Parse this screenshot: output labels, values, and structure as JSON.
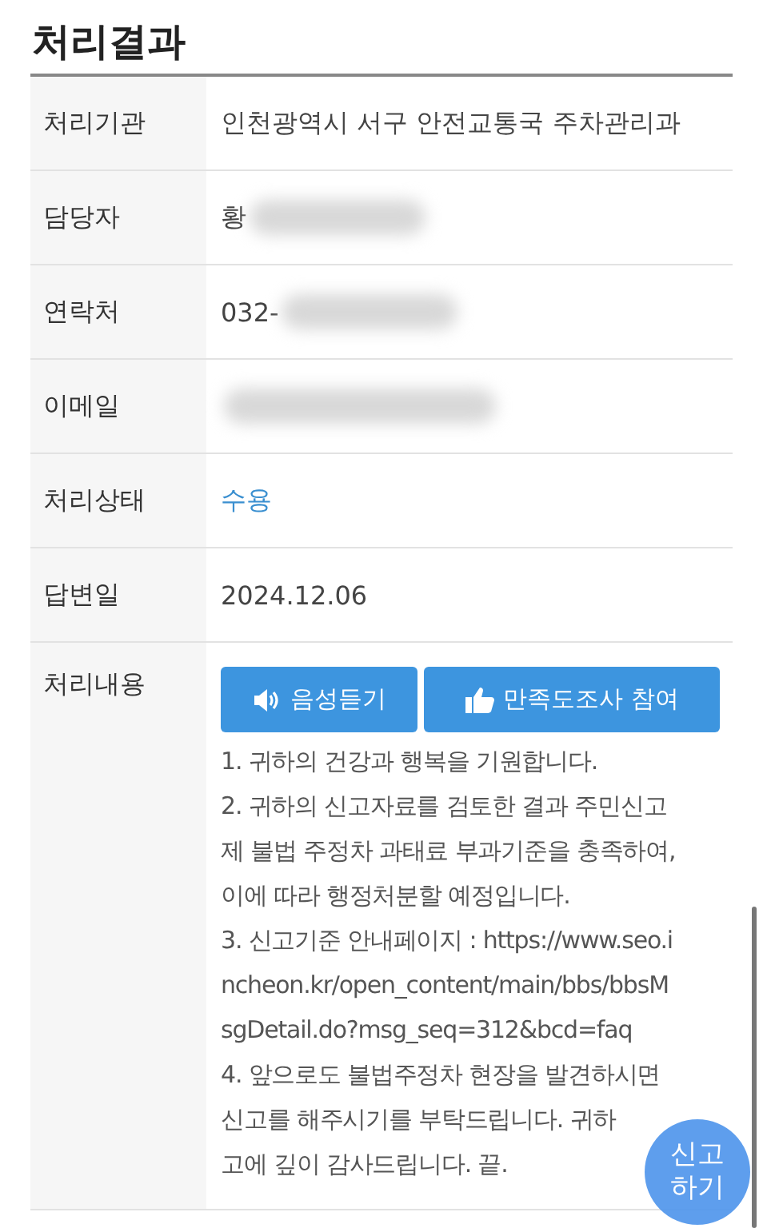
{
  "title": "처리결과",
  "rows": [
    {
      "label": "처리기관",
      "value": "인천광역시 서구 안전교통국 주차관리과",
      "kind": "text",
      "redacted": false
    },
    {
      "label": "담당자",
      "value": "황",
      "kind": "text",
      "redacted": true
    },
    {
      "label": "연락처",
      "value": "032-",
      "kind": "text",
      "redacted": true
    },
    {
      "label": "이메일",
      "kind": "text",
      "redacted": true
    },
    {
      "label": "처리상태",
      "value": "수용",
      "kind": "status",
      "redacted": false
    },
    {
      "label": "답변일",
      "value": "2024.12.06",
      "kind": "text",
      "redacted": false
    },
    {
      "label": "처리내용",
      "kind": "content",
      "redacted": false,
      "buttons": [
        {
          "label": "음성듣기"
        },
        {
          "label": "만족도조사 참여"
        }
      ],
      "paragraphs": [
        {
          "lines": [
            "1. 귀하의 건강과 행복을 기원합니다."
          ]
        },
        {
          "lines": [
            "2. 귀하의 신고자료를 검토한 결과 주민신고",
            "제 불법 주정차 과태료 부과기준을 충족하여,",
            "이에 따라 행정처분할 예정입니다."
          ]
        },
        {
          "lines": [
            "3. 신고기준 안내페이지 : https://www.seo.i",
            "ncheon.kr/open_content/main/bbs/bbsM",
            "sgDetail.do?msg_seq=312&bcd=faq"
          ]
        },
        {
          "lines": [
            "4. 앞으로도 불법주정차 현장을 발견하시면",
            "신고를 해주시기를 부탁드립니다. 귀하",
            "고에 깊이 감사드립니다. 끝."
          ]
        }
      ]
    }
  ],
  "fab": {
    "lines": [
      "신고",
      "하기"
    ]
  }
}
